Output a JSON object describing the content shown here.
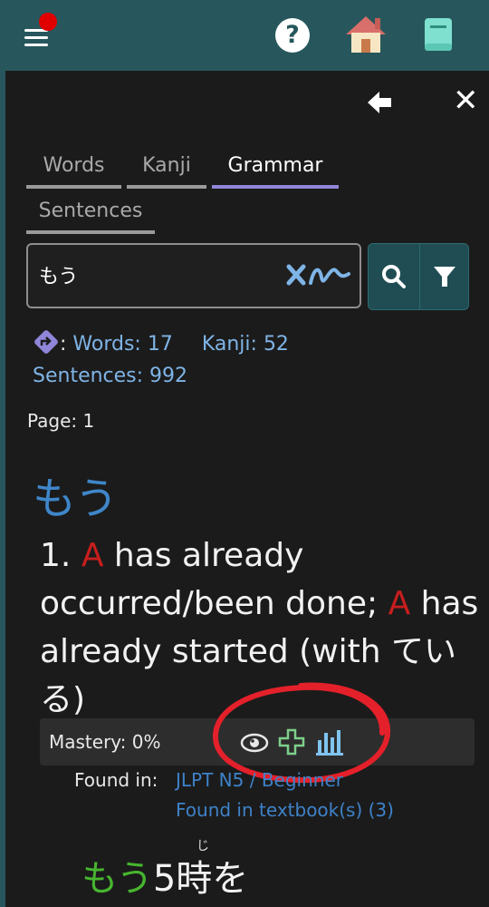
{
  "topbar": {
    "menu_icon": "hamburger-menu-icon",
    "notification_color": "#e00000",
    "help_label": "?",
    "home_icon": "house-icon",
    "book_icon": "book-icon"
  },
  "panel": {
    "back_icon": "back-arrow-icon",
    "close_label": "✕"
  },
  "tabs": [
    {
      "label": "Words",
      "active": false
    },
    {
      "label": "Kanji",
      "active": false
    },
    {
      "label": "Grammar",
      "active": true
    },
    {
      "label": "Sentences",
      "active": false
    }
  ],
  "search": {
    "value": "もう",
    "clear_icon": "clear-handwriting-icon",
    "search_icon": "magnifier-icon",
    "filter_icon": "funnel-icon"
  },
  "counts": {
    "colon": ":",
    "words": "Words: 17",
    "kanji": "Kanji: 52",
    "sentences": "Sentences: 992"
  },
  "page_label": "Page: 1",
  "entry": {
    "headword": "もう",
    "number": "1.",
    "a1": "A",
    "text1": " has already occurred/been done; ",
    "a2": "A",
    "text2": " has already started (with ている)",
    "mastery": "Mastery: 0%",
    "found_label": "Found in:",
    "found_level": "JLPT N5 / Beginner",
    "found_textbook": "Found in textbook(s) (3)"
  },
  "example": {
    "green_part": "もう",
    "rest": "5時を",
    "furigana": "じ"
  },
  "colors": {
    "accent_teal": "#27575d",
    "tab_active": "#8f86d9",
    "link_blue": "#3e82c9",
    "highlight_red": "#c81e1e",
    "annotation_red": "#e4202a",
    "green": "#47b52f"
  }
}
